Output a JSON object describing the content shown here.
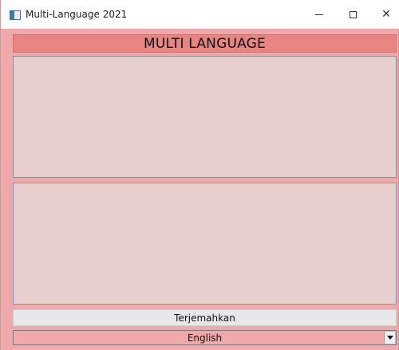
{
  "window": {
    "title": "Multi-Language 2021",
    "controls": {
      "minimize_icon": "minimize-icon",
      "maximize_icon": "maximize-icon",
      "close_glyph": "✕"
    }
  },
  "header": {
    "title": "MULTI LANGUAGE"
  },
  "output": {
    "text": ""
  },
  "input": {
    "value": "",
    "placeholder": ""
  },
  "actions": {
    "translate_label": "Terjemahkan"
  },
  "language": {
    "selected": "English"
  },
  "colors": {
    "background": "#f1a8aa",
    "header": "#e88582",
    "text_area": "#e6cfcd",
    "button": "#e8e8e8"
  }
}
